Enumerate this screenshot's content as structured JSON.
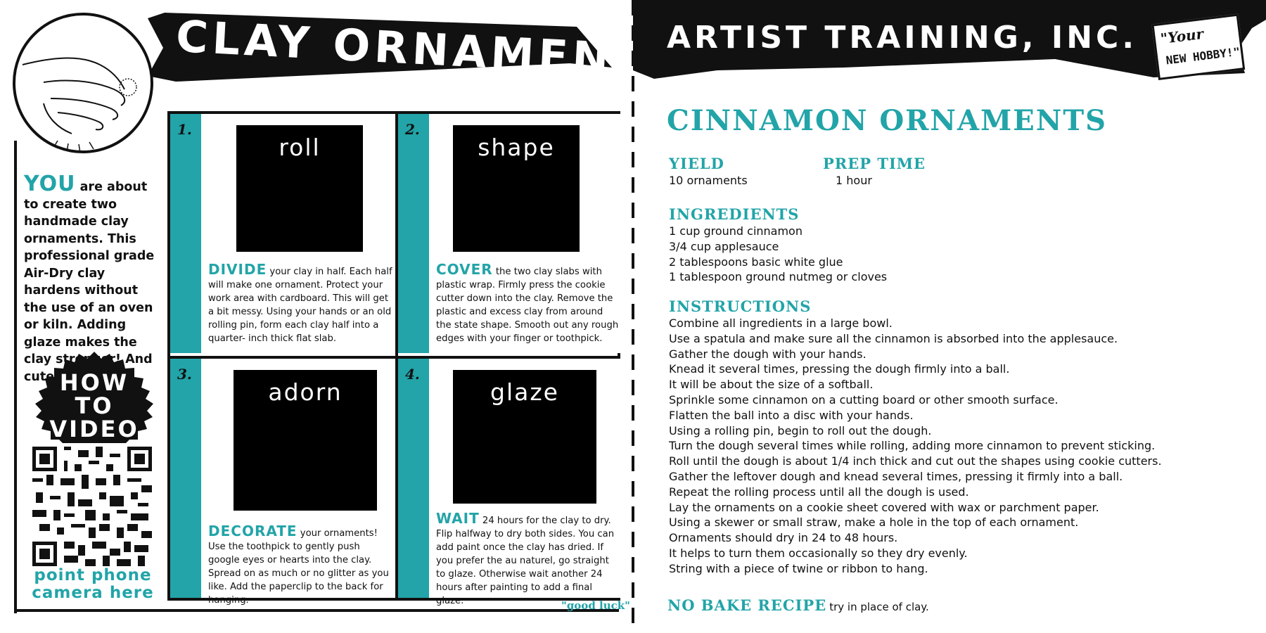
{
  "left": {
    "banner_title": "CLAY ORNAMENT",
    "intro_lead": "YOU",
    "intro_text": " are about to create two handmade clay ornaments. This professional grade Air-Dry clay hardens without the use of an oven or kiln. Adding glaze makes the clay stronger! And cuter!",
    "howto_lines": [
      "HOW",
      "TO",
      "VIDEO"
    ],
    "qr_caption_lines": [
      "point phone",
      "camera here"
    ],
    "steps": [
      {
        "number": "1.",
        "photo_label": "roll",
        "lead": "DIVIDE",
        "text": " your clay in half. Each half will make one ornament. Protect your work area with cardboard. This will get a bit messy. Using your hands or an old rolling pin, form each clay half into a quarter- inch thick flat slab."
      },
      {
        "number": "2.",
        "photo_label": "shape",
        "lead": "COVER",
        "text": " the two clay slabs with plastic wrap. Firmly press the cookie cutter down into the clay. Remove the plastic and excess clay from around the state shape. Smooth out any rough edges with your finger or toothpick."
      },
      {
        "number": "3.",
        "photo_label": "adorn",
        "lead": "DECORATE",
        "text": " your ornaments! Use the toothpick to gently push google eyes or hearts into the clay. Spread on as much or no glitter as you like. Add the paperclip to the back for hanging."
      },
      {
        "number": "4.",
        "photo_label": "glaze",
        "lead": "WAIT",
        "text": " 24 hours for the clay to dry. Flip halfway to dry both sides. You can add paint once the clay has dried. If you prefer the au naturel, go straight to glaze. Otherwise wait another 24 hours after painting to add a final glaze."
      }
    ],
    "sign_off": "\"good luck\""
  },
  "right": {
    "banner_title": "ARTIST TRAINING, INC.",
    "hobby_your": "\"Your",
    "hobby_new": "NEW HOBBY!\"",
    "recipe_title": "CINNAMON ORNAMENTS",
    "yield_label": "YIELD",
    "yield_value": "10 ornaments",
    "prep_label": "PREP TIME",
    "prep_value": "1 hour",
    "ingredients_label": "INGREDIENTS",
    "ingredients": [
      "1 cup ground cinnamon",
      "3/4 cup applesauce",
      "2 tablespoons basic white glue",
      "1 tablespoon ground nutmeg or cloves"
    ],
    "instructions_label": "INSTRUCTIONS",
    "instructions": [
      "Combine all ingredients in a large bowl.",
      "Use a spatula and make sure all the cinnamon is absorbed into the applesauce.",
      "Gather the dough with your hands.",
      "Knead it several times, pressing the dough firmly into a ball.",
      "It will be about the size of a softball.",
      "Sprinkle some cinnamon on a cutting board or other smooth surface.",
      "Flatten the ball into a disc with your hands.",
      "Using a rolling pin, begin to roll out the dough.",
      "Turn the dough several times while rolling, adding more cinnamon to prevent sticking.",
      "Roll until the dough is about 1/4 inch thick and cut out the shapes using cookie cutters.",
      "Gather the leftover dough and knead several times, pressing it firmly into a ball.",
      "Repeat the rolling process until all the dough is used.",
      "Lay the ornaments on a cookie sheet covered with wax or parchment paper.",
      "Using a skewer or small straw, make a hole in the top of each ornament.",
      "Ornaments should dry in 24 to 48 hours.",
      "It helps to turn them occasionally so they dry evenly.",
      "String with a piece of twine or ribbon to hang."
    ],
    "nobake_label": "NO BAKE RECIPE",
    "nobake_note": "try in place of clay."
  },
  "colors": {
    "accent_teal": "#22a4a8",
    "ink": "#111111",
    "paper": "#ffffff"
  },
  "icons": [
    "hand-illustration-icon",
    "qr-code-icon",
    "book-icon"
  ]
}
